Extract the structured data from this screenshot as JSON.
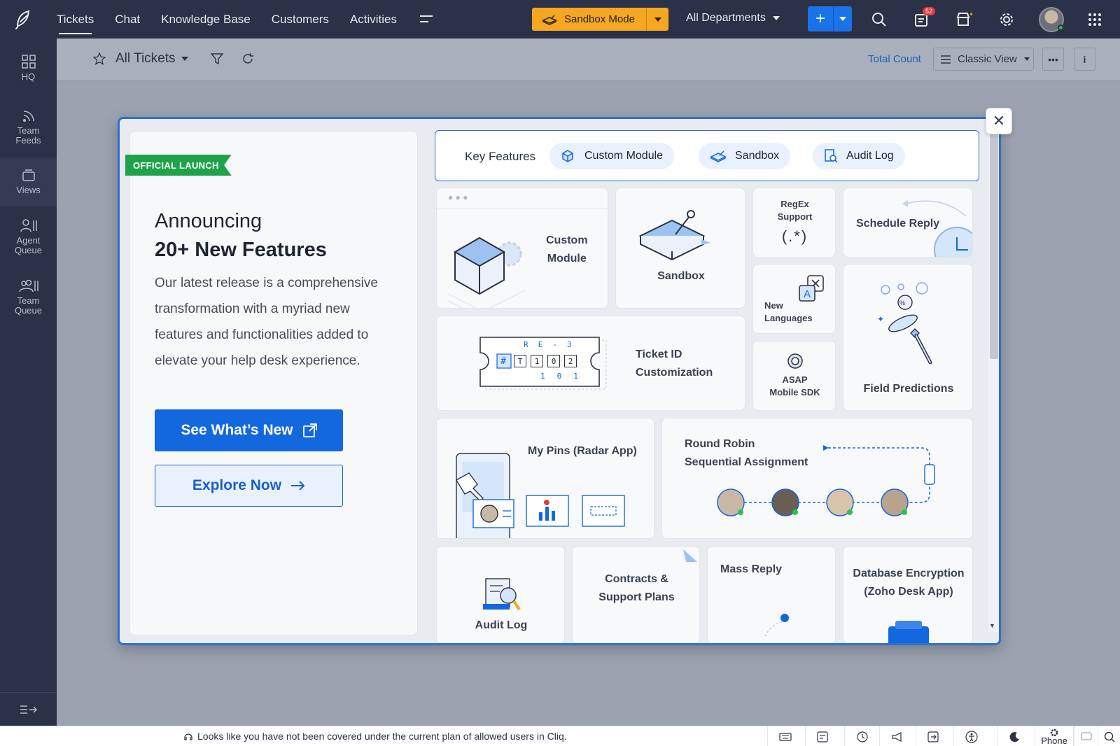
{
  "topbar": {
    "nav": [
      {
        "label": "Tickets",
        "active": true
      },
      {
        "label": "Chat"
      },
      {
        "label": "Knowledge Base"
      },
      {
        "label": "Customers"
      },
      {
        "label": "Activities"
      }
    ],
    "sandbox_label": "Sandbox Mode",
    "departments_label": "All Departments",
    "notification_count": "52"
  },
  "sidebar": {
    "items": [
      {
        "label": "HQ",
        "icon": "grid-icon"
      },
      {
        "label": "Team\nFeeds",
        "icon": "feed-icon"
      },
      {
        "label": "Views",
        "icon": "folder-icon",
        "active": true
      },
      {
        "label": "Agent\nQueue",
        "icon": "agent-queue-icon"
      },
      {
        "label": "Team\nQueue",
        "icon": "team-queue-icon"
      }
    ]
  },
  "subheader": {
    "view_title": "All Tickets",
    "total_count_label": "Total Count",
    "view_mode": "Classic View"
  },
  "modal": {
    "ribbon": "OFFICIAL LAUNCH",
    "heading_line1": "Announcing",
    "heading_line2": "20+ New Features",
    "description": "Our latest release is a comprehensive transformation with a myriad new features and functionalities added to elevate your help desk experience.",
    "primary_button": "See What’s New",
    "secondary_button": "Explore Now",
    "key_features_label": "Key Features",
    "key_features": [
      "Custom Module",
      "Sandbox",
      "Audit Log"
    ],
    "cards": {
      "custom_module": "Custom\nModule",
      "sandbox": "Sandbox",
      "regex": "RegEx\nSupport",
      "regex_symbol": "(.*)",
      "schedule_reply": "Schedule Reply",
      "new_languages": "New\nLanguages",
      "field_predictions": "Field Predictions",
      "ticket_id": "Ticket ID\nCustomization",
      "asap": "ASAP\nMobile SDK",
      "my_pins": "My Pins (Radar App)",
      "round_robin": "Round Robin\nSequential Assignment",
      "audit_log": "Audit Log",
      "contracts": "Contracts &\nSupport Plans",
      "mass_reply": "Mass Reply",
      "db_encryption": "Database Encryption\n(Zoho Desk App)"
    },
    "ticket_id_grid": {
      "row1": [
        "R",
        "E",
        "-",
        "3"
      ],
      "row2": [
        "#",
        "T",
        "1",
        "0",
        "2"
      ],
      "row3": [
        "1",
        "0",
        "1"
      ]
    }
  },
  "statusbar": {
    "message": "Looks like you have not been covered under the current plan of allowed users in Cliq.",
    "phone_label": "Phone"
  },
  "colors": {
    "topbar": "#2b3146",
    "accent": "#1368de",
    "sandbox": "#f5a623",
    "ribbon": "#1fa34a"
  }
}
